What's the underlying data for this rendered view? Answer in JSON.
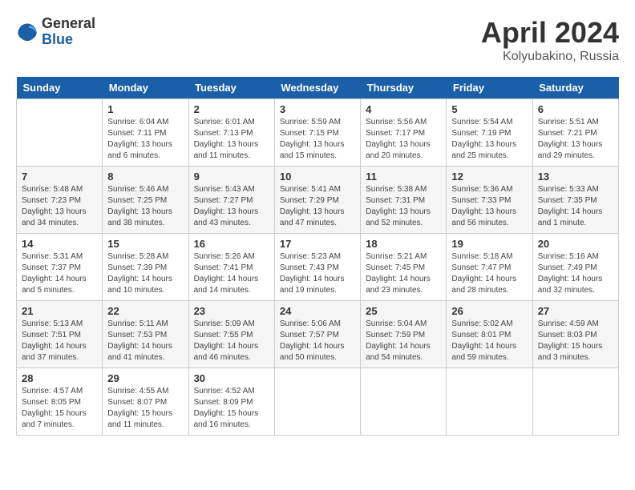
{
  "logo": {
    "general": "General",
    "blue": "Blue"
  },
  "title": {
    "month": "April 2024",
    "location": "Kolyubakino, Russia"
  },
  "weekdays": [
    "Sunday",
    "Monday",
    "Tuesday",
    "Wednesday",
    "Thursday",
    "Friday",
    "Saturday"
  ],
  "weeks": [
    [
      {
        "day": "",
        "info": ""
      },
      {
        "day": "1",
        "info": "Sunrise: 6:04 AM\nSunset: 7:11 PM\nDaylight: 13 hours\nand 6 minutes."
      },
      {
        "day": "2",
        "info": "Sunrise: 6:01 AM\nSunset: 7:13 PM\nDaylight: 13 hours\nand 11 minutes."
      },
      {
        "day": "3",
        "info": "Sunrise: 5:59 AM\nSunset: 7:15 PM\nDaylight: 13 hours\nand 15 minutes."
      },
      {
        "day": "4",
        "info": "Sunrise: 5:56 AM\nSunset: 7:17 PM\nDaylight: 13 hours\nand 20 minutes."
      },
      {
        "day": "5",
        "info": "Sunrise: 5:54 AM\nSunset: 7:19 PM\nDaylight: 13 hours\nand 25 minutes."
      },
      {
        "day": "6",
        "info": "Sunrise: 5:51 AM\nSunset: 7:21 PM\nDaylight: 13 hours\nand 29 minutes."
      }
    ],
    [
      {
        "day": "7",
        "info": "Sunrise: 5:48 AM\nSunset: 7:23 PM\nDaylight: 13 hours\nand 34 minutes."
      },
      {
        "day": "8",
        "info": "Sunrise: 5:46 AM\nSunset: 7:25 PM\nDaylight: 13 hours\nand 38 minutes."
      },
      {
        "day": "9",
        "info": "Sunrise: 5:43 AM\nSunset: 7:27 PM\nDaylight: 13 hours\nand 43 minutes."
      },
      {
        "day": "10",
        "info": "Sunrise: 5:41 AM\nSunset: 7:29 PM\nDaylight: 13 hours\nand 47 minutes."
      },
      {
        "day": "11",
        "info": "Sunrise: 5:38 AM\nSunset: 7:31 PM\nDaylight: 13 hours\nand 52 minutes."
      },
      {
        "day": "12",
        "info": "Sunrise: 5:36 AM\nSunset: 7:33 PM\nDaylight: 13 hours\nand 56 minutes."
      },
      {
        "day": "13",
        "info": "Sunrise: 5:33 AM\nSunset: 7:35 PM\nDaylight: 14 hours\nand 1 minute."
      }
    ],
    [
      {
        "day": "14",
        "info": "Sunrise: 5:31 AM\nSunset: 7:37 PM\nDaylight: 14 hours\nand 5 minutes."
      },
      {
        "day": "15",
        "info": "Sunrise: 5:28 AM\nSunset: 7:39 PM\nDaylight: 14 hours\nand 10 minutes."
      },
      {
        "day": "16",
        "info": "Sunrise: 5:26 AM\nSunset: 7:41 PM\nDaylight: 14 hours\nand 14 minutes."
      },
      {
        "day": "17",
        "info": "Sunrise: 5:23 AM\nSunset: 7:43 PM\nDaylight: 14 hours\nand 19 minutes."
      },
      {
        "day": "18",
        "info": "Sunrise: 5:21 AM\nSunset: 7:45 PM\nDaylight: 14 hours\nand 23 minutes."
      },
      {
        "day": "19",
        "info": "Sunrise: 5:18 AM\nSunset: 7:47 PM\nDaylight: 14 hours\nand 28 minutes."
      },
      {
        "day": "20",
        "info": "Sunrise: 5:16 AM\nSunset: 7:49 PM\nDaylight: 14 hours\nand 32 minutes."
      }
    ],
    [
      {
        "day": "21",
        "info": "Sunrise: 5:13 AM\nSunset: 7:51 PM\nDaylight: 14 hours\nand 37 minutes."
      },
      {
        "day": "22",
        "info": "Sunrise: 5:11 AM\nSunset: 7:53 PM\nDaylight: 14 hours\nand 41 minutes."
      },
      {
        "day": "23",
        "info": "Sunrise: 5:09 AM\nSunset: 7:55 PM\nDaylight: 14 hours\nand 46 minutes."
      },
      {
        "day": "24",
        "info": "Sunrise: 5:06 AM\nSunset: 7:57 PM\nDaylight: 14 hours\nand 50 minutes."
      },
      {
        "day": "25",
        "info": "Sunrise: 5:04 AM\nSunset: 7:59 PM\nDaylight: 14 hours\nand 54 minutes."
      },
      {
        "day": "26",
        "info": "Sunrise: 5:02 AM\nSunset: 8:01 PM\nDaylight: 14 hours\nand 59 minutes."
      },
      {
        "day": "27",
        "info": "Sunrise: 4:59 AM\nSunset: 8:03 PM\nDaylight: 15 hours\nand 3 minutes."
      }
    ],
    [
      {
        "day": "28",
        "info": "Sunrise: 4:57 AM\nSunset: 8:05 PM\nDaylight: 15 hours\nand 7 minutes."
      },
      {
        "day": "29",
        "info": "Sunrise: 4:55 AM\nSunset: 8:07 PM\nDaylight: 15 hours\nand 11 minutes."
      },
      {
        "day": "30",
        "info": "Sunrise: 4:52 AM\nSunset: 8:09 PM\nDaylight: 15 hours\nand 16 minutes."
      },
      {
        "day": "",
        "info": ""
      },
      {
        "day": "",
        "info": ""
      },
      {
        "day": "",
        "info": ""
      },
      {
        "day": "",
        "info": ""
      }
    ]
  ]
}
